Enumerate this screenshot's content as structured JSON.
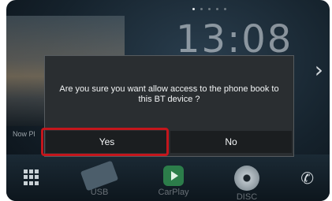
{
  "home": {
    "clock": "13:08",
    "now_playing": "Now Pl",
    "sources": [
      {
        "label": "USB",
        "icon": "usb-icon"
      },
      {
        "label": "CarPlay",
        "icon": "carplay-icon"
      },
      {
        "label": "DISC",
        "icon": "disc-icon"
      }
    ],
    "icons": {
      "menu": "grid-menu-icon",
      "phone": "phone-icon",
      "next": "chevron-right-icon"
    },
    "page_dots": 5,
    "active_page": 1
  },
  "dialog": {
    "message": "Are you sure you want allow access to the phone book to this BT device ?",
    "yes_label": "Yes",
    "no_label": "No",
    "highlighted_button": "Yes"
  },
  "colors": {
    "highlight": "#c4161c",
    "dialog_bg": "#2a2e31",
    "button_bg": "#1b1e20"
  }
}
